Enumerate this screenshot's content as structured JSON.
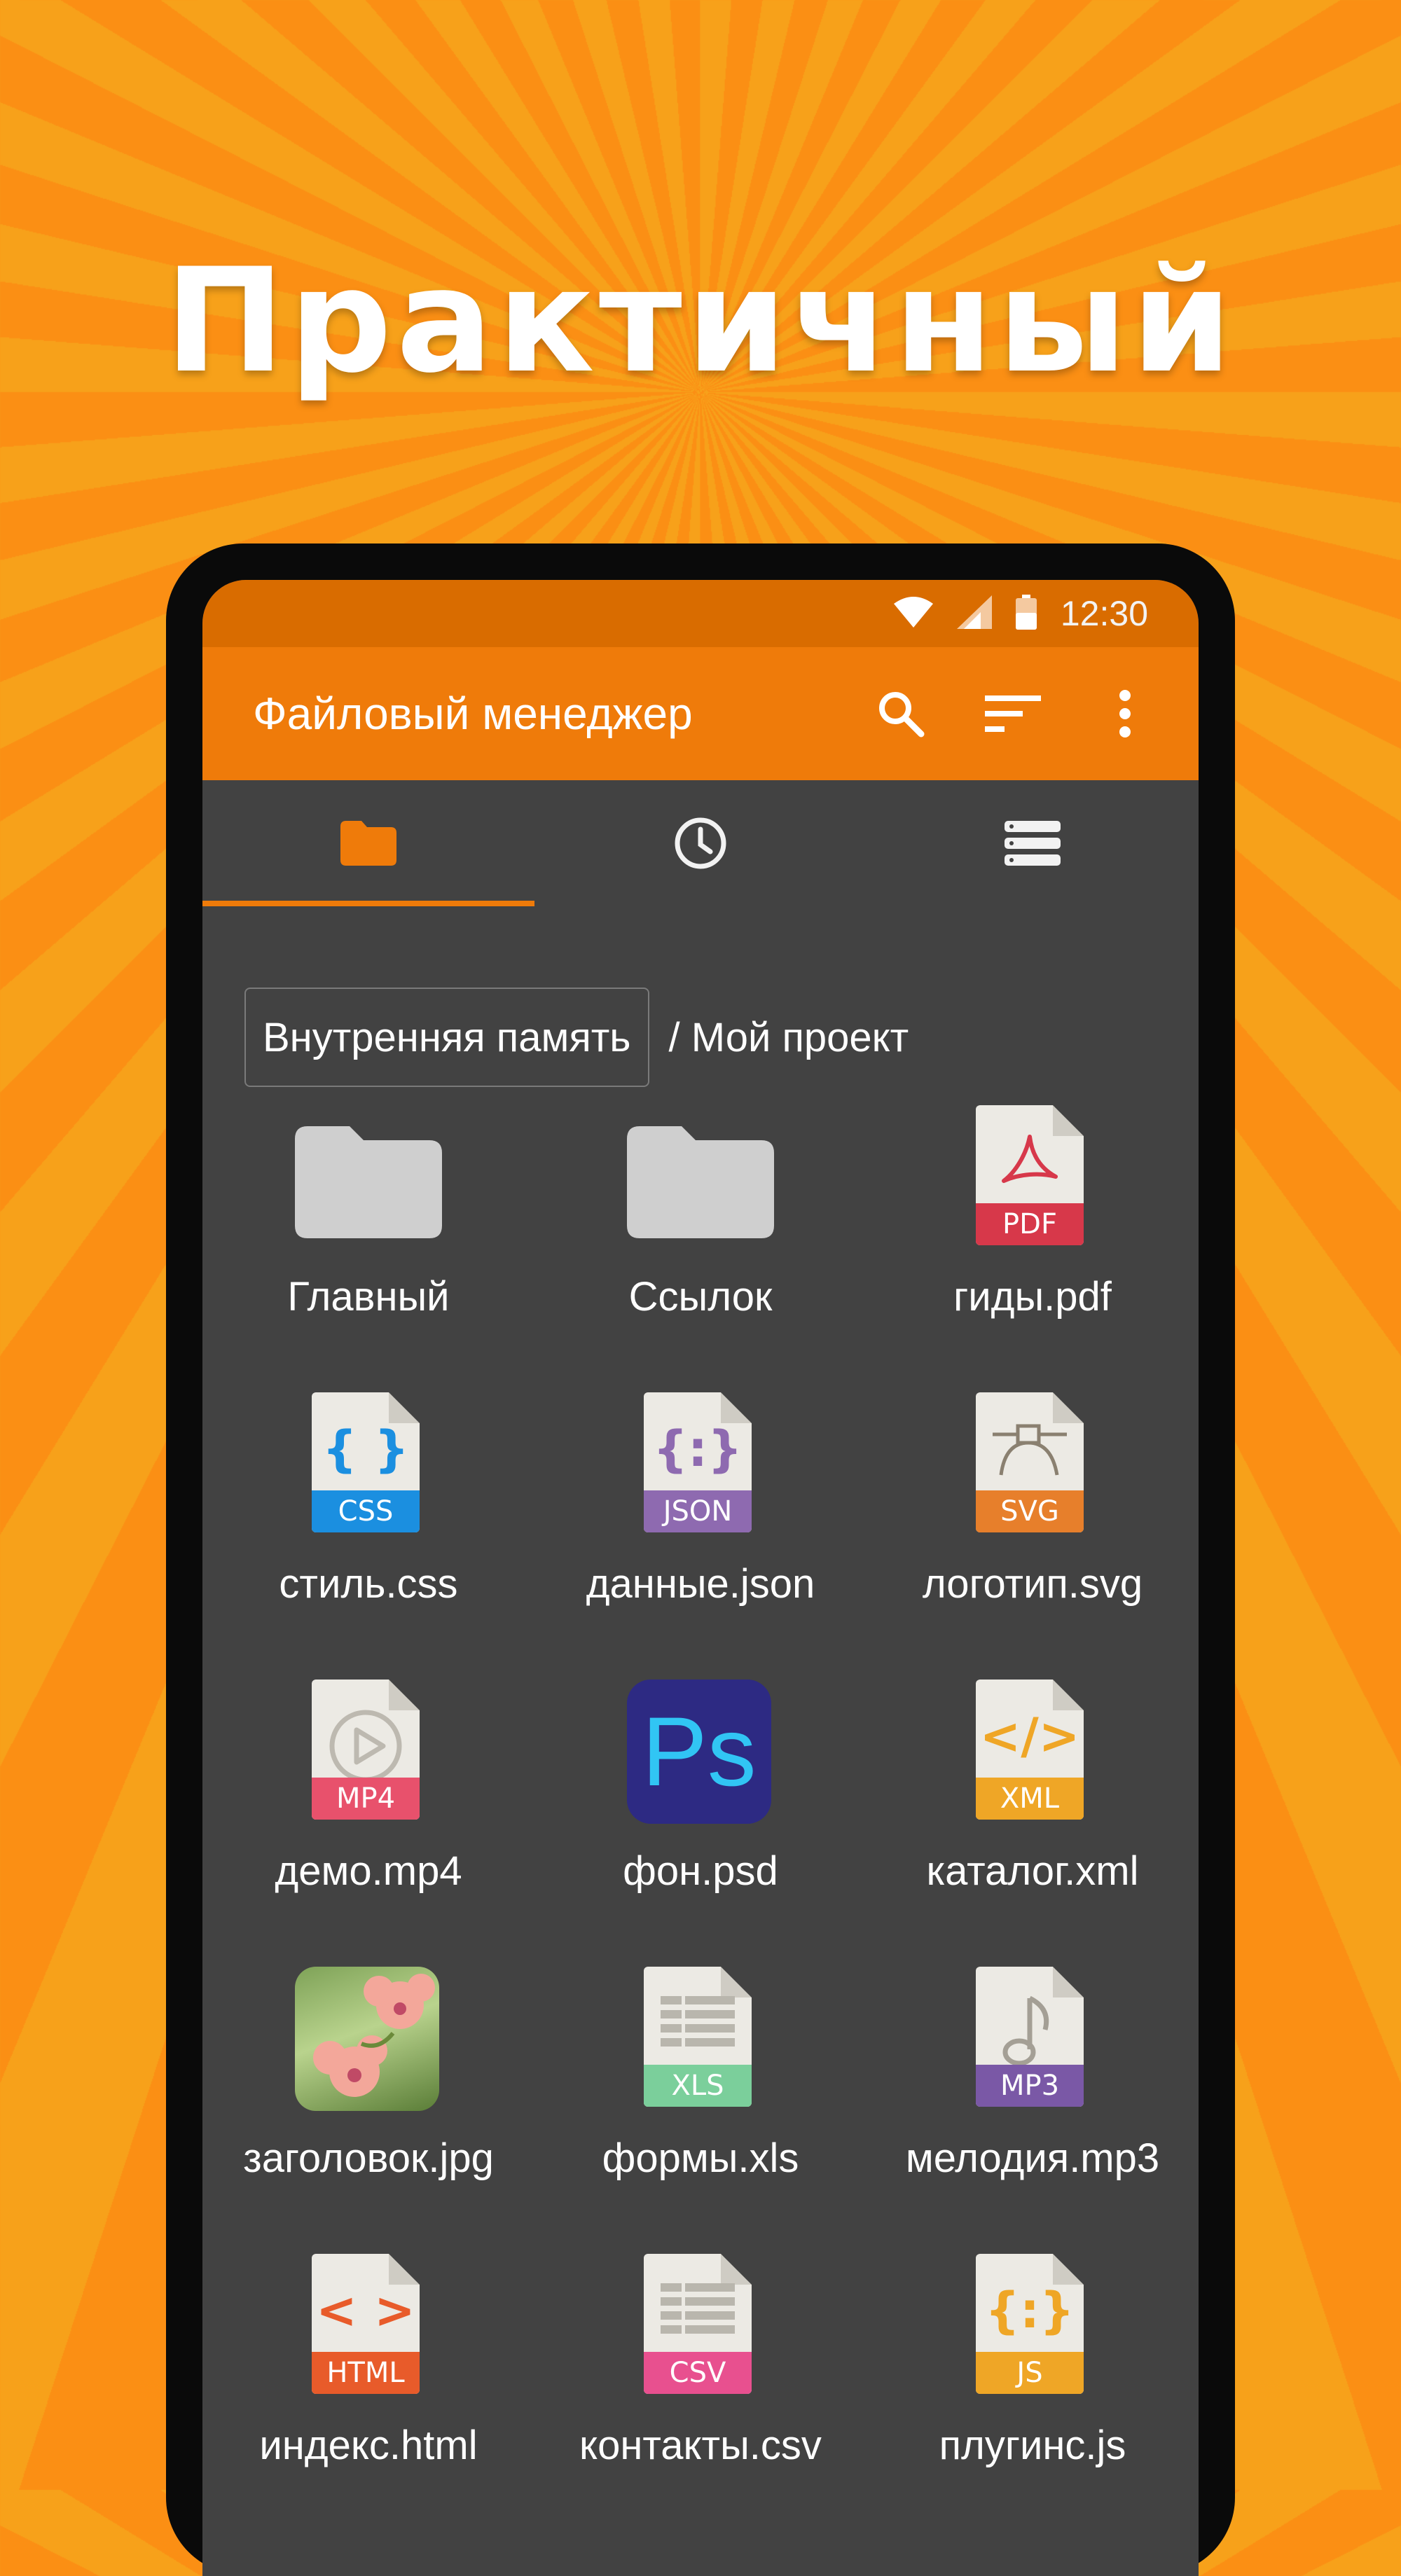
{
  "headline": "Практичный",
  "status_bar": {
    "time": "12:30"
  },
  "app_bar": {
    "title": "Файловый менеджер"
  },
  "tabs": [
    {
      "name": "folders",
      "icon": "folder-icon",
      "selected": true
    },
    {
      "name": "recent",
      "icon": "clock-icon",
      "selected": false
    },
    {
      "name": "storage",
      "icon": "storage-list-icon",
      "selected": false
    }
  ],
  "breadcrumb": {
    "root": "Внутренняя память",
    "path": "/ Мой проект"
  },
  "files": [
    {
      "label": "Главный",
      "type": "folder"
    },
    {
      "label": "Ссылок",
      "type": "folder"
    },
    {
      "label": "гиды.pdf",
      "type": "doc",
      "badge": "PDF",
      "color": "#d7384a",
      "glyph": "pdf-acrobat-icon"
    },
    {
      "label": "стиль.css",
      "type": "doc",
      "badge": "CSS",
      "color": "#1b8fe0",
      "glyph": "{ }"
    },
    {
      "label": "данные.json",
      "type": "doc",
      "badge": "JSON",
      "color": "#8e6ab0",
      "glyph": "{:}"
    },
    {
      "label": "логотип.svg",
      "type": "doc",
      "badge": "SVG",
      "color": "#e77f2b",
      "glyph": "svg-vector-icon"
    },
    {
      "label": "демо.mp4",
      "type": "doc",
      "badge": "MP4",
      "color": "#e8516c",
      "glyph": "play-icon"
    },
    {
      "label": "фон.psd",
      "type": "ps",
      "badge": "Ps"
    },
    {
      "label": "каталог.xml",
      "type": "doc",
      "badge": "XML",
      "color": "#efa626",
      "glyph": "</>"
    },
    {
      "label": "заголовок.jpg",
      "type": "photo"
    },
    {
      "label": "формы.xls",
      "type": "doc",
      "badge": "XLS",
      "color": "#7bcf9b",
      "glyph": "sheet-icon"
    },
    {
      "label": "мелодия.mp3",
      "type": "doc",
      "badge": "MP3",
      "color": "#7a58a6",
      "glyph": "music-note-icon"
    },
    {
      "label": "индекс.html",
      "type": "doc",
      "badge": "HTML",
      "color": "#e85b2a",
      "glyph": "< >"
    },
    {
      "label": "контакты.csv",
      "type": "doc",
      "badge": "CSV",
      "color": "#e8508f",
      "glyph": "sheet-icon"
    },
    {
      "label": "плугинс.js",
      "type": "doc",
      "badge": "JS",
      "color": "#efa626",
      "glyph": "{:}"
    }
  ],
  "colors": {
    "accent": "#ef7b0a",
    "status": "#d96c00",
    "surface": "#424242"
  }
}
